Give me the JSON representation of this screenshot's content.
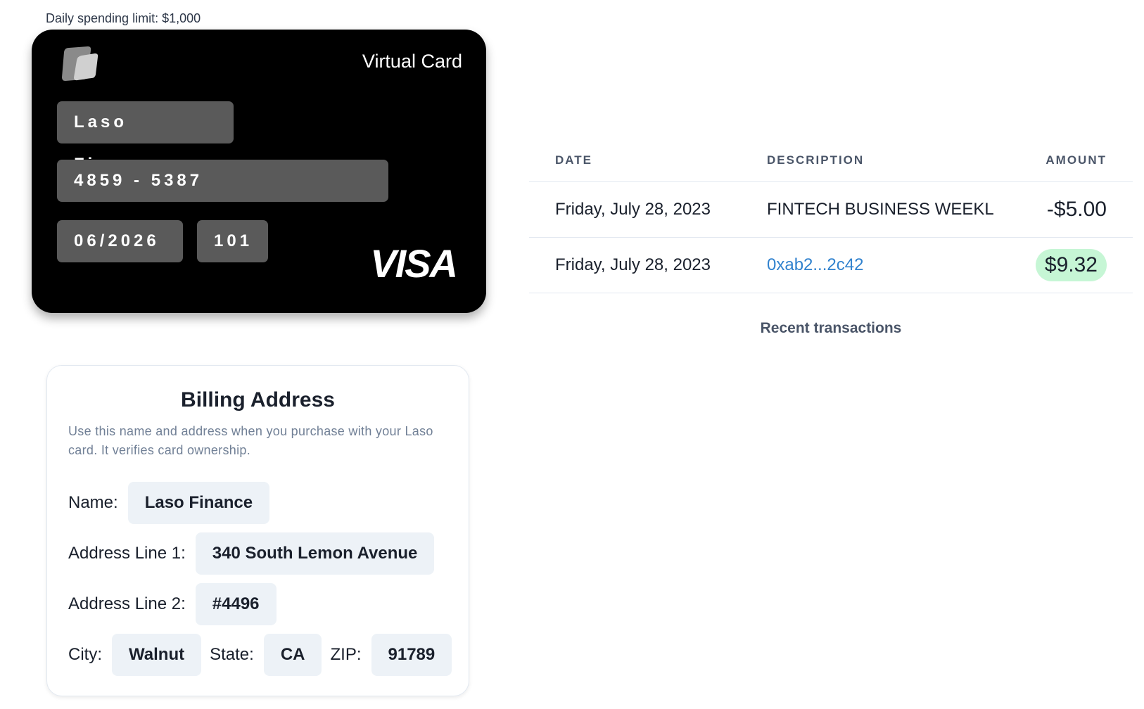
{
  "card": {
    "daily_limit": "Daily spending limit: $1,000",
    "kind": "Virtual Card",
    "name": "Laso Finance",
    "number": "4859 - 5387",
    "expiry": "06/2026",
    "cvv": "101",
    "network": "VISA",
    "background_color": "#000000",
    "field_color": "#5a5a5a"
  },
  "billing": {
    "title": "Billing Address",
    "description": "Use this name and address when you purchase with your Laso card. It verifies card ownership.",
    "name_label": "Name:",
    "name_value": "Laso Finance",
    "addr1_label": "Address Line 1:",
    "addr1_value": "340 South Lemon Avenue",
    "addr2_label": "Address Line 2:",
    "addr2_value": "#4496",
    "city_label": "City:",
    "city_value": "Walnut",
    "state_label": "State:",
    "state_value": "CA",
    "zip_label": "ZIP:",
    "zip_value": "91789",
    "field_color": "#edf2f7"
  },
  "transactions": {
    "headers": {
      "date": "DATE",
      "description": "DESCRIPTION",
      "amount": "AMOUNT"
    },
    "rows": [
      {
        "date": "Friday, July 28, 2023",
        "description": "FINTECH BUSINESS WEEKL",
        "amount": "-$5.00"
      },
      {
        "date": "Friday, July 28, 2023",
        "description": "0xab2...2c42",
        "amount": "$9.32"
      }
    ],
    "caption": "Recent transactions",
    "positive_badge_color": "#c6f6d5",
    "link_color": "#3182ce"
  }
}
